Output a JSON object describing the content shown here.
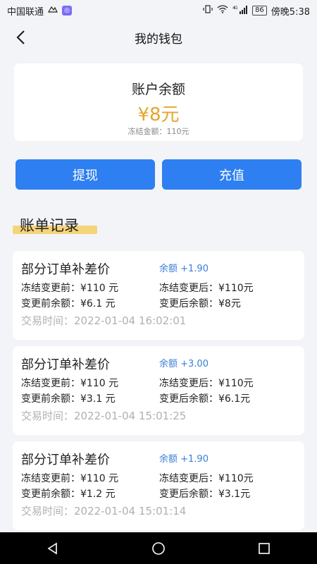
{
  "status_bar": {
    "carrier": "中国联通",
    "time": "傍晚5:38",
    "battery": "86",
    "network": "4G"
  },
  "header": {
    "title": "我的钱包"
  },
  "balance": {
    "label": "账户余额",
    "amount": "¥8元",
    "frozen": "冻结金额：110元",
    "amount_color": "#e3a62c"
  },
  "actions": {
    "withdraw_label": "提现",
    "recharge_label": "充值",
    "button_color": "#2e7ff1"
  },
  "bills": {
    "section_title": "账单记录",
    "items": [
      {
        "title": "部分订单补差价",
        "change": "余额 +1.90",
        "frozen_before": "冻结变更前：¥110 元",
        "frozen_after": "冻结变更后：¥110元",
        "balance_before": "变更前余额：¥6.1 元",
        "balance_after": "变更后余额：¥8元",
        "time": "交易时间：2022-01-04 16:02:01"
      },
      {
        "title": "部分订单补差价",
        "change": "余额 +3.00",
        "frozen_before": "冻结变更前：¥110 元",
        "frozen_after": "冻结变更后：¥110元",
        "balance_before": "变更前余额：¥3.1 元",
        "balance_after": "变更后余额：¥6.1元",
        "time": "交易时间：2022-01-04 15:01:25"
      },
      {
        "title": "部分订单补差价",
        "change": "余额 +1.90",
        "frozen_before": "冻结变更前：¥110 元",
        "frozen_after": "冻结变更后：¥110元",
        "balance_before": "变更前余额：¥1.2 元",
        "balance_after": "变更后余额：¥3.1元",
        "time": "交易时间：2022-01-04 15:01:14"
      }
    ]
  },
  "nav": {
    "icons": [
      "back-triangle-icon",
      "home-circle-icon",
      "recents-square-icon"
    ]
  }
}
